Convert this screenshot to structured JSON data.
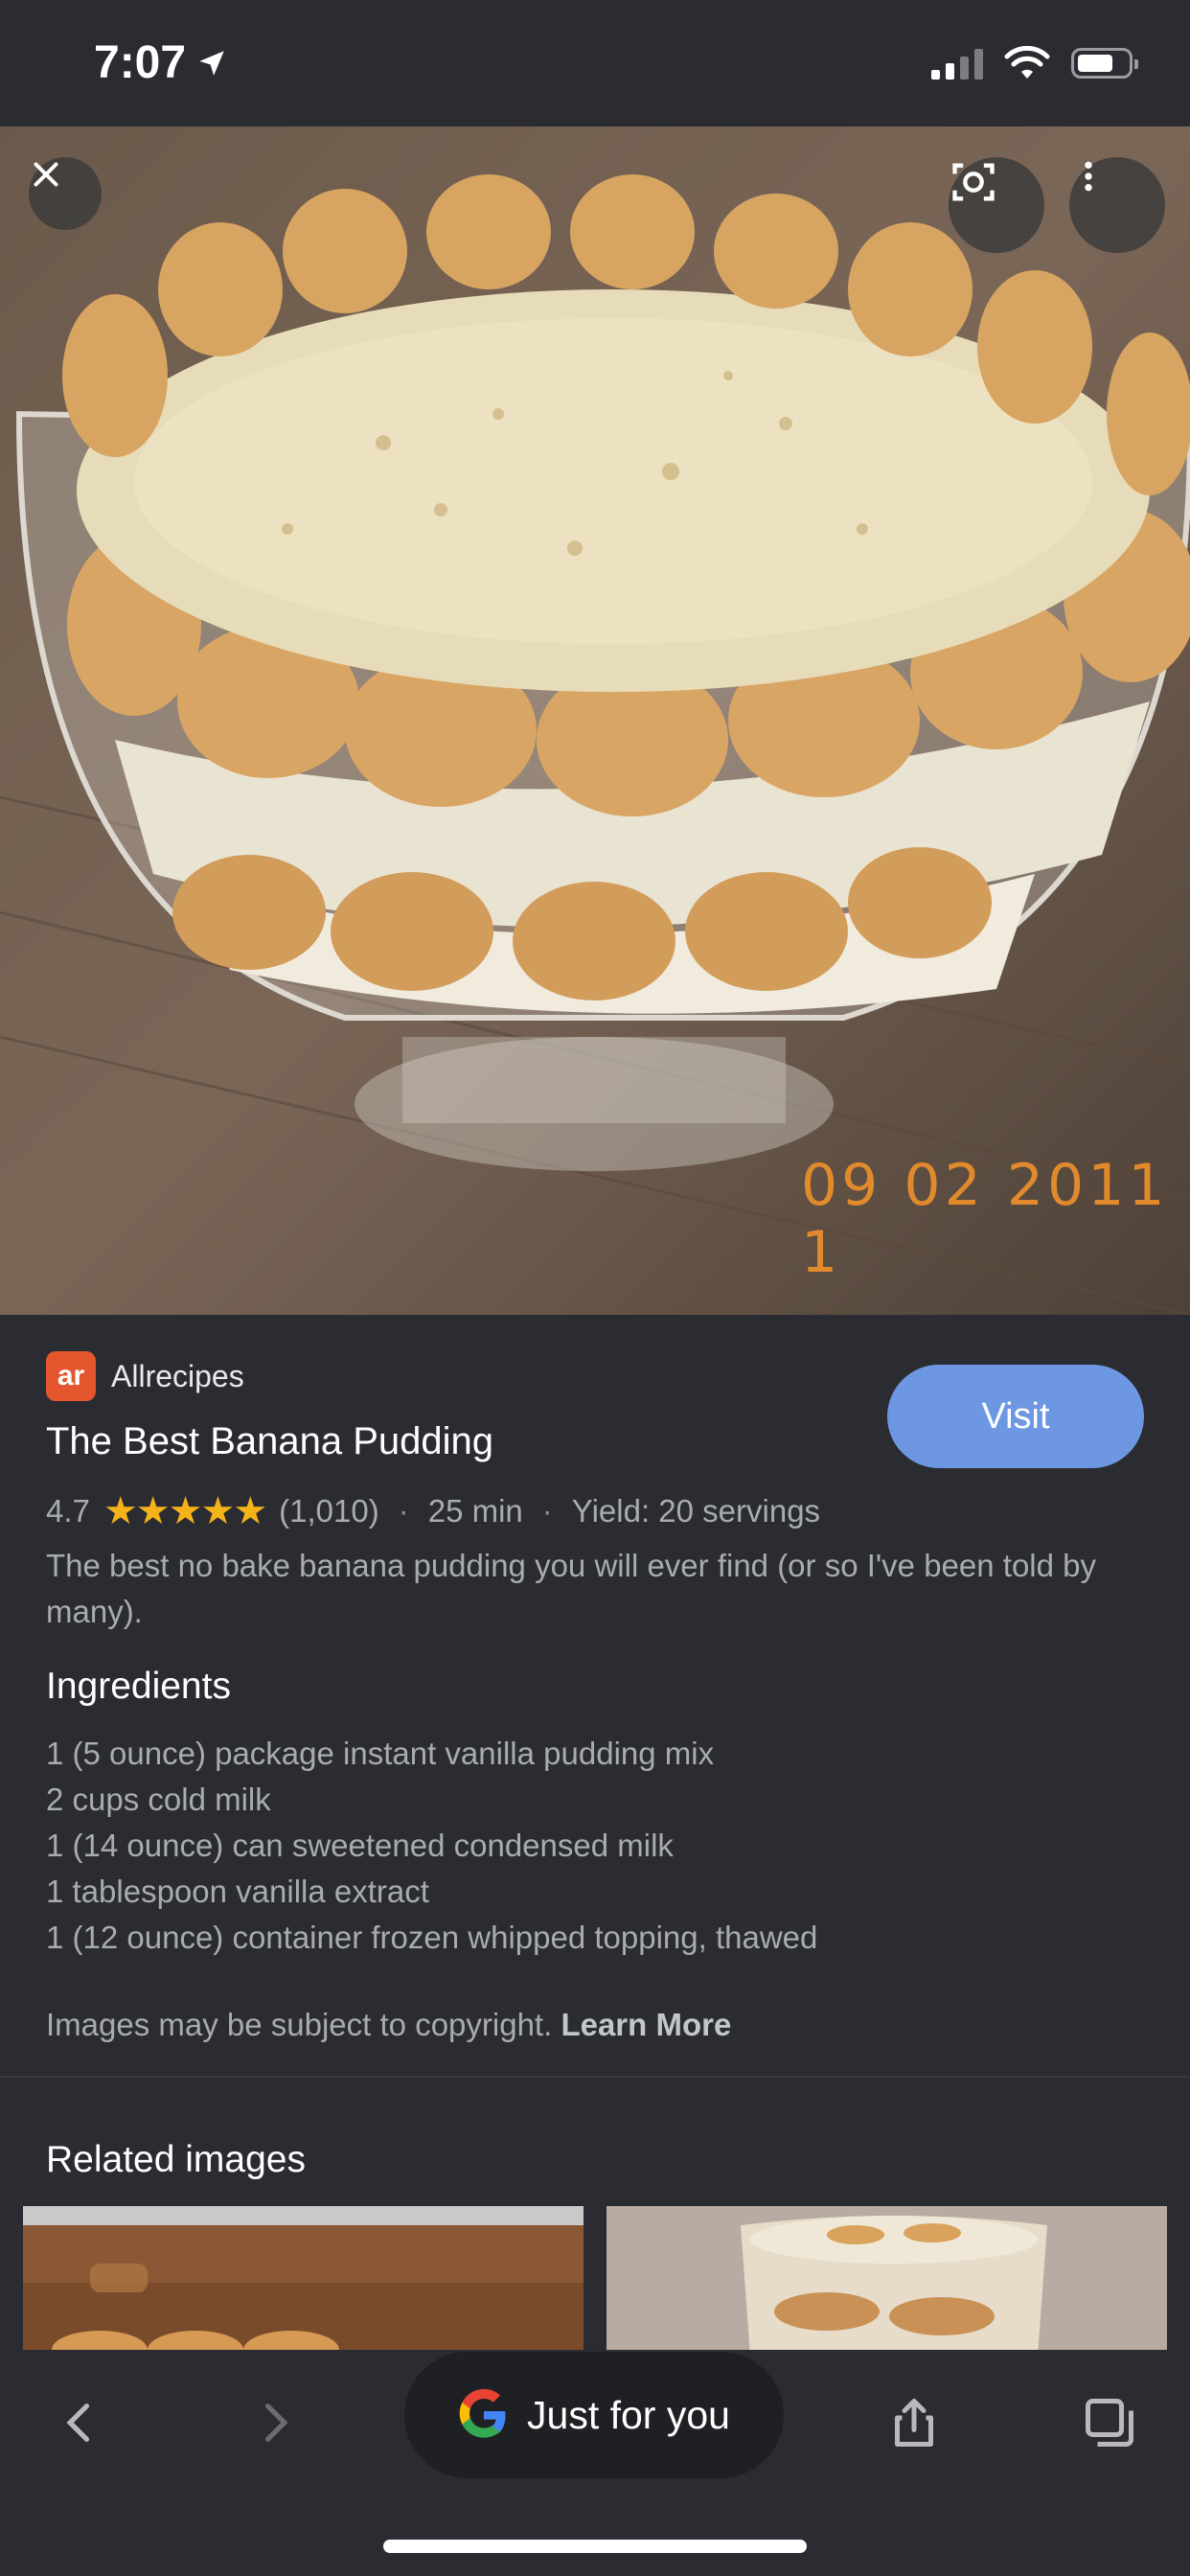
{
  "status_bar": {
    "time": "7:07"
  },
  "source": {
    "logo_text": "ar",
    "name": "Allrecipes"
  },
  "recipe": {
    "title": "The Best Banana Pudding",
    "rating": "4.7",
    "rating_value": 4.7,
    "review_count": "(1,010)",
    "time": "25 min",
    "yield": "Yield: 20 servings",
    "description": "The best no bake banana pudding you will ever find (or so I've been told by many)."
  },
  "visit_label": "Visit",
  "image": {
    "date_stamp": "09 02 2011 1"
  },
  "ingredients": {
    "title": "Ingredients",
    "items": [
      "1 (5 ounce) package instant vanilla pudding mix",
      "2 cups cold milk",
      "1 (14 ounce) can sweetened condensed milk",
      "1 tablespoon vanilla extract",
      "1 (12 ounce) container frozen whipped topping, thawed"
    ]
  },
  "copyright": {
    "text": "Images may be subject to copyright.",
    "link": "Learn More"
  },
  "related": {
    "title": "Related images"
  },
  "bottom_bar": {
    "just_for_you_label": "Just for you"
  },
  "icons": {
    "close": "close-icon",
    "lens": "lens-icon",
    "more": "more-vert-icon",
    "back": "chevron-left-icon",
    "forward": "chevron-right-icon",
    "share": "share-icon",
    "tabs": "tabs-icon",
    "google": "google-g-icon"
  },
  "colors": {
    "accent": "#6d97e3",
    "star": "#f5b31a",
    "background": "#2b2c31"
  }
}
